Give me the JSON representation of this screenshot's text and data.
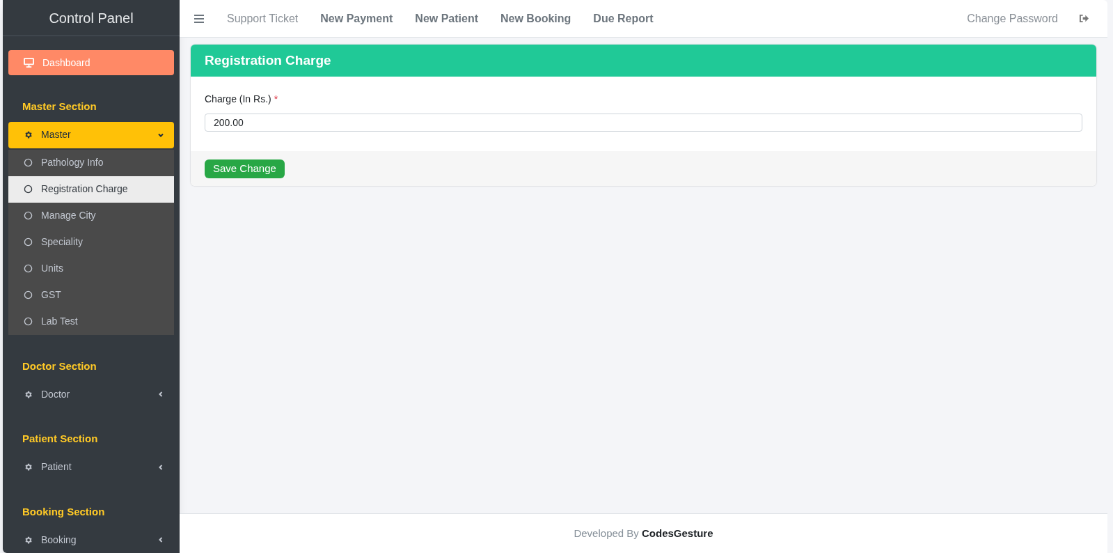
{
  "sidebar": {
    "title": "Control Panel",
    "dashboard": {
      "label": "Dashboard",
      "selected": true
    },
    "sections": [
      {
        "heading": "Master Section",
        "group": {
          "label": "Master",
          "expanded": true,
          "children": [
            {
              "label": "Pathology Info",
              "selected": false
            },
            {
              "label": "Registration Charge",
              "selected": true
            },
            {
              "label": "Manage City",
              "selected": false
            },
            {
              "label": "Speciality",
              "selected": false
            },
            {
              "label": "Units",
              "selected": false
            },
            {
              "label": "GST",
              "selected": false
            },
            {
              "label": "Lab Test",
              "selected": false
            }
          ]
        }
      },
      {
        "heading": "Doctor Section",
        "group": {
          "label": "Doctor",
          "expanded": false
        }
      },
      {
        "heading": "Patient Section",
        "group": {
          "label": "Patient",
          "expanded": false
        }
      },
      {
        "heading": "Booking Section",
        "group": {
          "label": "Booking",
          "expanded": false
        }
      }
    ]
  },
  "topbar": {
    "links": [
      {
        "label": "Support Ticket",
        "emphasized": false
      },
      {
        "label": "New Payment",
        "emphasized": true
      },
      {
        "label": "New Patient",
        "emphasized": true
      },
      {
        "label": "New Booking",
        "emphasized": true
      },
      {
        "label": "Due Report",
        "emphasized": true
      }
    ],
    "right_link": "Change Password"
  },
  "card": {
    "title": "Registration Charge",
    "field": {
      "label": "Charge (In Rs.)",
      "required_mark": "*",
      "value": "200.00"
    },
    "button": "Save Change"
  },
  "footer": "Developed By **CodesGesture**"
}
